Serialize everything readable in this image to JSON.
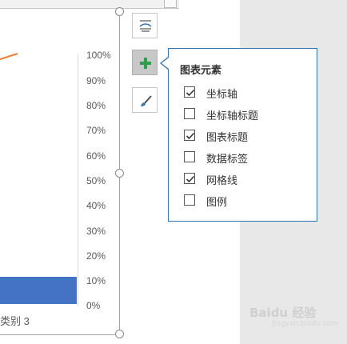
{
  "chart": {
    "y_ticks": [
      "100%",
      "90%",
      "80%",
      "70%",
      "60%",
      "50%",
      "40%",
      "30%",
      "20%",
      "10%",
      "0%"
    ],
    "category_label": "类别 3",
    "bar_color": "#4472c4",
    "line_color": "#ed7d31"
  },
  "side_buttons": [
    {
      "icon": "chart-styles-icon"
    },
    {
      "icon": "add-chart-element-icon"
    },
    {
      "icon": "chart-filter-brush-icon"
    }
  ],
  "popup": {
    "title": "图表元素",
    "options": [
      {
        "label": "坐标轴",
        "checked": true
      },
      {
        "label": "坐标轴标题",
        "checked": false
      },
      {
        "label": "图表标题",
        "checked": true
      },
      {
        "label": "数据标签",
        "checked": false
      },
      {
        "label": "网格线",
        "checked": true
      },
      {
        "label": "图例",
        "checked": false
      }
    ]
  },
  "watermark": {
    "text": "Baidu 经验",
    "sub": "jingyan.baidu.com"
  }
}
